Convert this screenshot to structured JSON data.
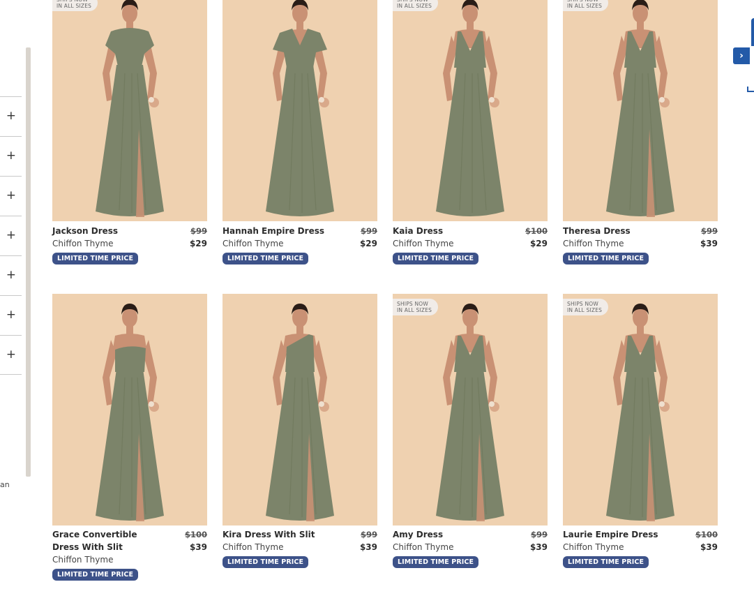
{
  "sidebar": {
    "filters": [
      "+",
      "+",
      "+",
      "+",
      "+",
      "+",
      "+"
    ],
    "cut_text": "an"
  },
  "products": [
    {
      "name": "Jackson Dress",
      "color": "Chiffon Thyme",
      "old_price": "$99",
      "price": "$29",
      "badge": "LIMITED TIME PRICE",
      "ships_line1": "SHIPS NOW",
      "ships_line2": "IN ALL SIZES",
      "has_ships": true
    },
    {
      "name": "Hannah Empire Dress",
      "color": "Chiffon Thyme",
      "old_price": "$99",
      "price": "$29",
      "badge": "LIMITED TIME PRICE",
      "has_ships": false
    },
    {
      "name": "Kaia Dress",
      "color": "Chiffon Thyme",
      "old_price": "$100",
      "price": "$29",
      "badge": "LIMITED TIME PRICE",
      "ships_line1": "SHIPS NOW",
      "ships_line2": "IN ALL SIZES",
      "has_ships": true
    },
    {
      "name": "Theresa Dress",
      "color": "Chiffon Thyme",
      "old_price": "$99",
      "price": "$39",
      "badge": "LIMITED TIME PRICE",
      "ships_line1": "SHIPS NOW",
      "ships_line2": "IN ALL SIZES",
      "has_ships": true
    },
    {
      "name": "Grace Convertible Dress With Slit",
      "color": "Chiffon Thyme",
      "old_price": "$100",
      "price": "$39",
      "badge": "LIMITED TIME PRICE",
      "has_ships": false
    },
    {
      "name": "Kira Dress With Slit",
      "color": "Chiffon Thyme",
      "old_price": "$99",
      "price": "$39",
      "badge": "LIMITED TIME PRICE",
      "has_ships": false
    },
    {
      "name": "Amy Dress",
      "color": "Chiffon Thyme",
      "old_price": "$99",
      "price": "$39",
      "badge": "LIMITED TIME PRICE",
      "ships_line1": "SHIPS NOW",
      "ships_line2": "IN ALL SIZES",
      "has_ships": true
    },
    {
      "name": "Laurie Empire Dress",
      "color": "Chiffon Thyme",
      "old_price": "$100",
      "price": "$39",
      "badge": "LIMITED TIME PRICE",
      "ships_line1": "SHIPS NOW",
      "ships_line2": "IN ALL SIZES",
      "has_ships": true
    }
  ],
  "widget": {
    "arrow_icon": "chevron-right-icon",
    "arrow": "›"
  },
  "colors": {
    "badge": "#3d5289",
    "photo_bg": "#efd1b0",
    "dress": "#7c846a",
    "accent": "#235aa8"
  }
}
